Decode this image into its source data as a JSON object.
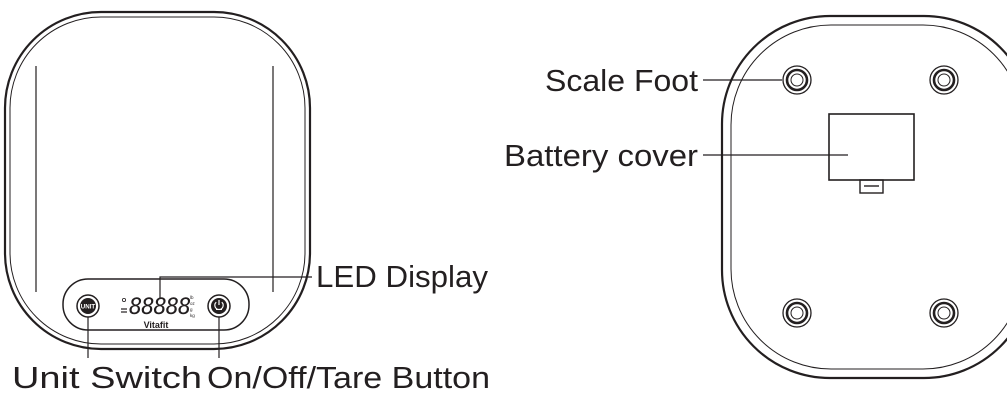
{
  "front_view": {
    "panel": {
      "unit_button_text": "UNIT",
      "display_digits": "88888",
      "unit_indicators": [
        "lb",
        "oz",
        "g",
        "kg"
      ],
      "brand": "Vitafit"
    },
    "labels": {
      "led_display": "LED Display",
      "unit_switch": "Unit Switch",
      "power_tare": "On/Off/Tare Button"
    }
  },
  "back_view": {
    "labels": {
      "scale_foot": "Scale Foot",
      "battery_cover": "Battery cover"
    }
  },
  "colors": {
    "line": "#231f20",
    "background": "#ffffff"
  }
}
